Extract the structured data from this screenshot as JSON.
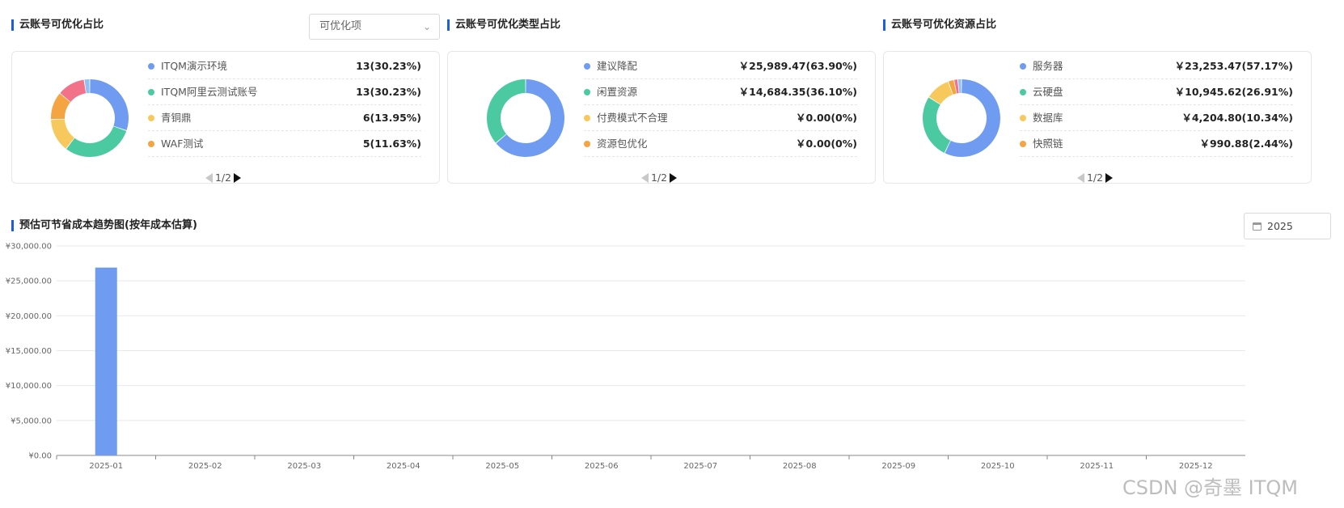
{
  "panels": [
    {
      "title": "云账号可优化占比",
      "items": [
        {
          "name": "ITQM演示环境",
          "value": "13(30.23%)",
          "color": "#6f9cf0"
        },
        {
          "name": "ITQM阿里云测试账号",
          "value": "13(30.23%)",
          "color": "#4bcaa2"
        },
        {
          "name": "青铜鼎",
          "value": "6(13.95%)",
          "color": "#f7c95c"
        },
        {
          "name": "WAF测试",
          "value": "5(11.63%)",
          "color": "#f5a442"
        }
      ],
      "pager": "1/2"
    },
    {
      "title": "云账号可优化类型占比",
      "items": [
        {
          "name": "建议降配",
          "value": "￥25,989.47(63.90%)",
          "color": "#6f9cf0"
        },
        {
          "name": "闲置资源",
          "value": "￥14,684.35(36.10%)",
          "color": "#4bcaa2"
        },
        {
          "name": "付费模式不合理",
          "value": "￥0.00(0%)",
          "color": "#f7c95c"
        },
        {
          "name": "资源包优化",
          "value": "￥0.00(0%)",
          "color": "#f5a442"
        }
      ],
      "pager": "1/2"
    },
    {
      "title": "云账号可优化资源占比",
      "items": [
        {
          "name": "服务器",
          "value": "￥23,253.47(57.17%)",
          "color": "#6f9cf0"
        },
        {
          "name": "云硬盘",
          "value": "￥10,945.62(26.91%)",
          "color": "#4bcaa2"
        },
        {
          "name": "数据库",
          "value": "￥4,204.80(10.34%)",
          "color": "#f7c95c"
        },
        {
          "name": "快照链",
          "value": "￥990.88(2.44%)",
          "color": "#f5a442"
        }
      ],
      "pager": "1/2"
    }
  ],
  "select": {
    "value": "可优化项"
  },
  "trend": {
    "title": "预估可节省成本趋势图(按年成本估算)",
    "year": "2025"
  },
  "chart_data": [
    {
      "type": "pie",
      "slices": [
        {
          "label": "ITQM演示环境",
          "percent": 30.23,
          "color": "#6f9cf0"
        },
        {
          "label": "ITQM阿里云测试账号",
          "percent": 30.23,
          "color": "#4bcaa2"
        },
        {
          "label": "青铜鼎",
          "percent": 13.95,
          "color": "#f7c95c"
        },
        {
          "label": "WAF测试",
          "percent": 11.63,
          "color": "#f5a442"
        },
        {
          "label": "",
          "percent": 11.63,
          "color": "#f2728a"
        },
        {
          "label": "",
          "percent": 2.33,
          "color": "#8fc1f2"
        }
      ]
    },
    {
      "type": "pie",
      "slices": [
        {
          "label": "建议降配",
          "percent": 63.9,
          "color": "#6f9cf0"
        },
        {
          "label": "闲置资源",
          "percent": 36.1,
          "color": "#4bcaa2"
        },
        {
          "label": "付费模式不合理",
          "percent": 0,
          "color": "#f7c95c"
        },
        {
          "label": "资源包优化",
          "percent": 0,
          "color": "#f5a442"
        }
      ]
    },
    {
      "type": "pie",
      "slices": [
        {
          "label": "服务器",
          "percent": 57.17,
          "color": "#6f9cf0"
        },
        {
          "label": "云硬盘",
          "percent": 26.91,
          "color": "#4bcaa2"
        },
        {
          "label": "数据库",
          "percent": 10.34,
          "color": "#f7c95c"
        },
        {
          "label": "快照链",
          "percent": 2.44,
          "color": "#f5a442"
        },
        {
          "label": "",
          "percent": 1.6,
          "color": "#f2728a"
        },
        {
          "label": "",
          "percent": 1.54,
          "color": "#8fc1f2"
        }
      ]
    },
    {
      "type": "bar",
      "categories": [
        "2025-01",
        "2025-02",
        "2025-03",
        "2025-04",
        "2025-05",
        "2025-06",
        "2025-07",
        "2025-08",
        "2025-09",
        "2025-10",
        "2025-11",
        "2025-12"
      ],
      "values": [
        26900,
        0,
        0,
        0,
        0,
        0,
        0,
        0,
        0,
        0,
        0,
        0
      ],
      "yticks": [
        "¥0.00",
        "¥5,000.00",
        "¥10,000.00",
        "¥15,000.00",
        "¥20,000.00",
        "¥25,000.00",
        "¥30,000.00"
      ],
      "ylim": [
        0,
        30000
      ],
      "grid": true,
      "color": "#6f9cf0"
    }
  ],
  "watermark": "CSDN @奇墨 ITQM"
}
